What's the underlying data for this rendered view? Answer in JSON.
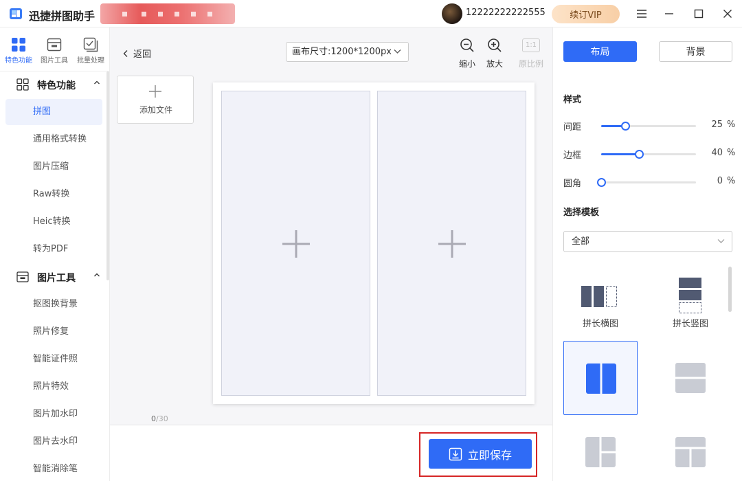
{
  "app": {
    "title": "迅捷拼图助手",
    "user_id": "12222222222555",
    "vip_label": "续订VIP",
    "colors": {
      "accent": "#2f6bf6",
      "highlight": "#d62626"
    }
  },
  "nav_tabs": [
    {
      "label": "特色功能",
      "icon": "grid-icon"
    },
    {
      "label": "图片工具",
      "icon": "image-tool-icon"
    },
    {
      "label": "批量处理",
      "icon": "batch-icon"
    }
  ],
  "groups": [
    {
      "title": "特色功能",
      "icon": "grid-icon"
    },
    {
      "title": "图片工具",
      "icon": "image-tool-icon"
    }
  ],
  "menu": {
    "feature_items": [
      "拼图",
      "通用格式转换",
      "图片压缩",
      "Raw转换",
      "Heic转换",
      "转为PDF"
    ],
    "tool_items": [
      "抠图换背景",
      "照片修复",
      "智能证件照",
      "照片特效",
      "图片加水印",
      "图片去水印",
      "智能消除笔"
    ]
  },
  "toolbar": {
    "back_label": "返回",
    "canvas_size": "画布尺寸:1200*1200px",
    "zoom_out": "缩小",
    "zoom_in": "放大",
    "ratio_box": "1:1",
    "original_ratio": "原比例"
  },
  "files": {
    "add_label": "添加文件",
    "count": "0",
    "max": "/30"
  },
  "save_label": "立即保存",
  "panel": {
    "tab_layout": "布局",
    "tab_background": "背景",
    "style_title": "样式",
    "sliders": [
      {
        "label": "间距",
        "value": 25,
        "unit": "%"
      },
      {
        "label": "边框",
        "value": 40,
        "unit": "%"
      },
      {
        "label": "圆角",
        "value": 0,
        "unit": "%"
      }
    ],
    "template_title": "选择模板",
    "template_filter": "全部",
    "templates": [
      {
        "name": "拼长横图"
      },
      {
        "name": "拼长竖图"
      }
    ]
  }
}
